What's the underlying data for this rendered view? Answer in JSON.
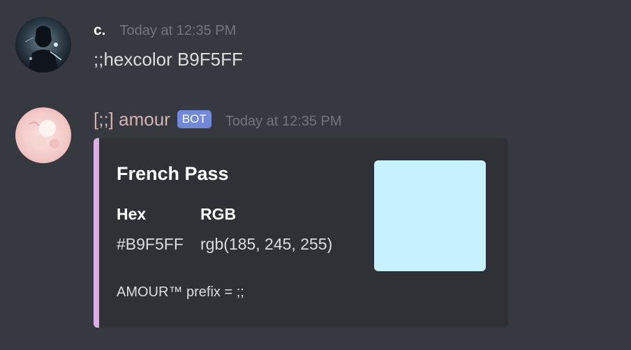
{
  "messages": [
    {
      "author": "c.",
      "timestamp": "Today at 12:35 PM",
      "content": ";;hexcolor B9F5FF"
    },
    {
      "author": "[;;] amour",
      "bot_tag": "BOT",
      "timestamp": "Today at 12:35 PM",
      "embed": {
        "title": "French Pass",
        "fields": [
          {
            "name": "Hex",
            "value": "#B9F5FF"
          },
          {
            "name": "RGB",
            "value": "rgb(185, 245, 255)"
          }
        ],
        "footer": "AMOUR™ prefix = ;;",
        "swatch_color": "#C7F1FF",
        "accent_color": "#DCAEE8"
      }
    }
  ],
  "colors": {
    "background": "#36393f",
    "embed_background": "#2f3136",
    "bot_tag": "#7289da",
    "timestamp": "#72767d",
    "amour_name": "#d6b3b3"
  }
}
